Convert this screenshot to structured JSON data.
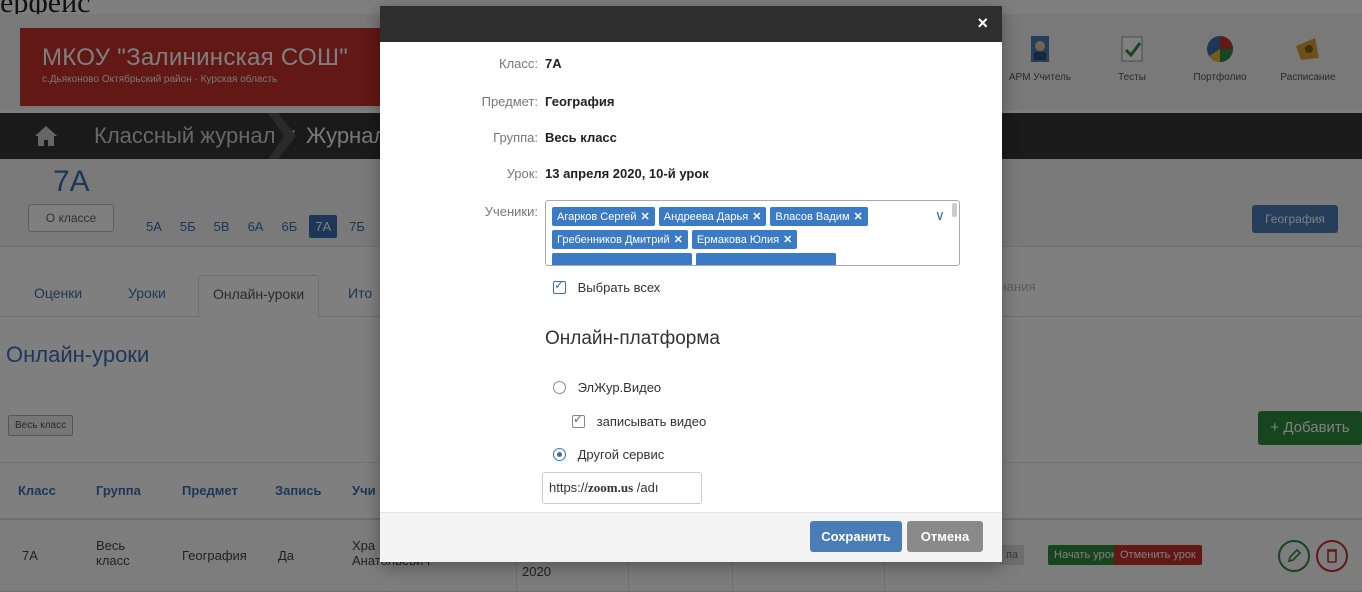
{
  "crop_text": "ерфейс",
  "school": {
    "name": "МКОУ \"Залининская СОШ\"",
    "address": "с.Дьяконово Октябрьский район · Курская область"
  },
  "topnav": [
    {
      "label": "АРМ Учитель",
      "icon": "teacher-icon"
    },
    {
      "label": "Тесты",
      "icon": "tests-icon"
    },
    {
      "label": "Портфолио",
      "icon": "portfolio-icon"
    },
    {
      "label": "Расписание",
      "icon": "schedule-icon"
    }
  ],
  "breadcrumb": {
    "item1": "Классный журнал ∨",
    "item2": "Журнал"
  },
  "class_nav": {
    "current": "7А",
    "about_btn": "О классе",
    "classes": [
      "5А",
      "5Б",
      "5В",
      "6А",
      "6Б",
      "7А",
      "7Б"
    ],
    "subject_btn": "География"
  },
  "tabs": [
    "Оценки",
    "Уроки",
    "Онлайн-уроки",
    "Ито"
  ],
  "tab_right": "чания",
  "section_title": "Онлайн-уроки",
  "group_filter": "Весь класс",
  "add_button": "+ Добавить",
  "table": {
    "headers": [
      "Класс",
      "Группа",
      "Предмет",
      "Запись",
      "Учи"
    ],
    "row": {
      "class": "7А",
      "group": "Весь класс",
      "subject": "География",
      "record": "Да",
      "teacher": "Хра Анатольевич",
      "date": "2020",
      "status": "па",
      "start": "Начать урок",
      "cancel": "Отменить урок"
    }
  },
  "modal": {
    "close": "×",
    "class_label": "Класс:",
    "class_value": "7А",
    "subject_label": "Предмет:",
    "subject_value": "География",
    "group_label": "Группа:",
    "group_value": "Весь класс",
    "lesson_label": "Урок:",
    "lesson_value": "13 апреля 2020, 10-й урок",
    "students_label": "Ученики:",
    "students": [
      "Агарков Сергей",
      "Андреева Дарья",
      "Власов Вадим",
      "Гребенников Дмитрий",
      "Ермакова Юлия"
    ],
    "select_all": "Выбрать всех",
    "platform_title": "Онлайн-платформа",
    "option1": "ЭлЖур.Видео",
    "record_video": "записывать видео",
    "option2": "Другой сервис",
    "url_prefix": "https://",
    "url_bold": "zoom.us",
    "url_suffix": " /adı",
    "save": "Сохранить",
    "cancel": "Отмена"
  },
  "colors": {
    "brand_red": "#c4302b",
    "accent_blue": "#3b6fb0",
    "success_green": "#2e8b3c"
  }
}
